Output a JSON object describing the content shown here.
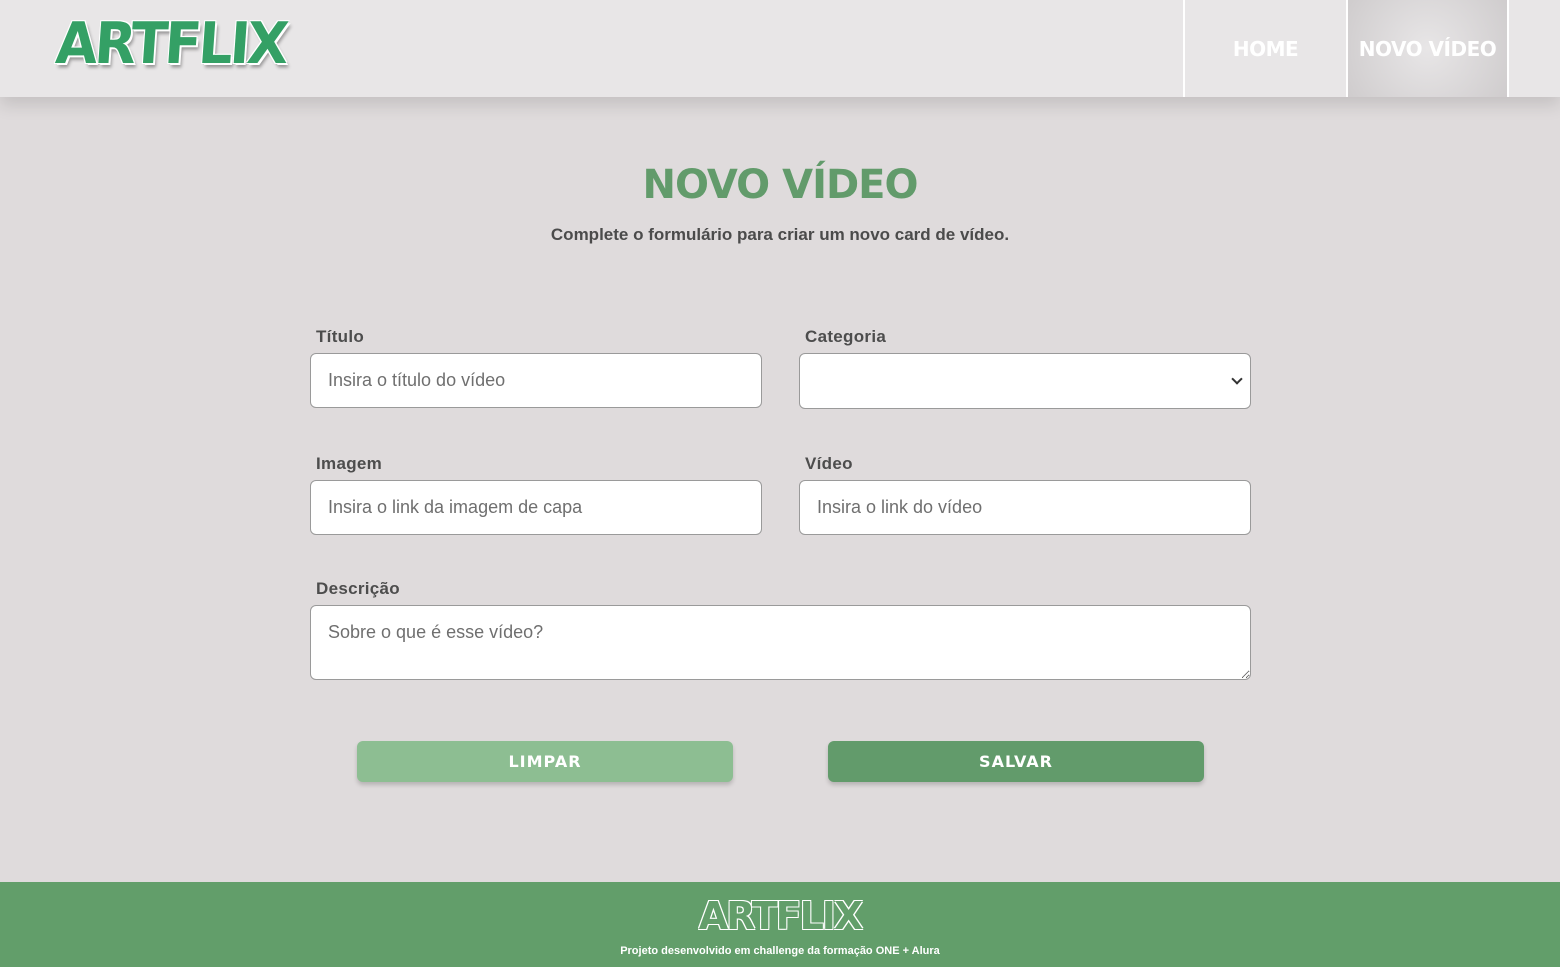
{
  "header": {
    "logo": "ARTFLIX",
    "nav": [
      {
        "label": "HOME"
      },
      {
        "label": "NOVO VÍDEO",
        "active": true
      }
    ]
  },
  "main": {
    "title": "NOVO VÍDEO",
    "subtitle": "Complete o formulário para criar um novo card de vídeo."
  },
  "form": {
    "titulo": {
      "label": "Título",
      "placeholder": "Insira o título do vídeo",
      "value": ""
    },
    "categoria": {
      "label": "Categoria",
      "value": ""
    },
    "imagem": {
      "label": "Imagem",
      "placeholder": "Insira o link da imagem de capa",
      "value": ""
    },
    "video": {
      "label": "Vídeo",
      "placeholder": "Insira o link do vídeo",
      "value": ""
    },
    "descricao": {
      "label": "Descrição",
      "placeholder": "Sobre o que é esse vídeo?",
      "value": ""
    },
    "clear_label": "LIMPAR",
    "save_label": "SALVAR"
  },
  "footer": {
    "logo": "ARTFLIX",
    "text": "Projeto desenvolvido em challenge da formação ONE + Alura"
  },
  "colors": {
    "accent": "#629b6b",
    "accent_light": "#8dbe92",
    "logo_green": "#34a065",
    "background": "#dfdbdc",
    "header_bg": "#e8e6e7"
  },
  "icons": {
    "select_arrow": "chevron-down-icon"
  }
}
